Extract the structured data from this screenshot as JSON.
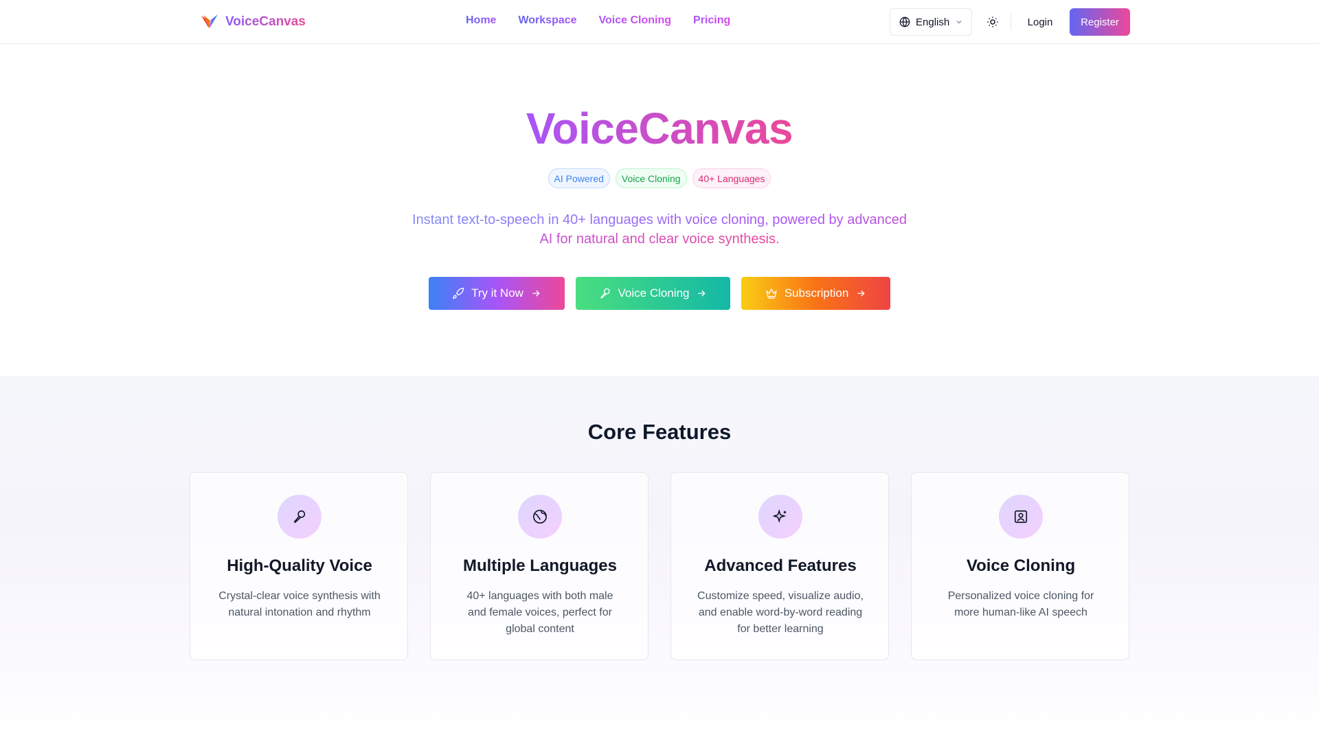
{
  "header": {
    "brand": "VoiceCanvas",
    "nav": [
      "Home",
      "Workspace",
      "Voice Cloning",
      "Pricing"
    ],
    "language": "English",
    "login": "Login",
    "register": "Register"
  },
  "hero": {
    "title": "VoiceCanvas",
    "badges": [
      "AI Powered",
      "Voice Cloning",
      "40+ Languages"
    ],
    "subtitle": "Instant text-to-speech in 40+ languages with voice cloning, powered by advanced AI for natural and clear voice synthesis.",
    "buttons": [
      "Try it Now",
      "Voice Cloning",
      "Subscription"
    ]
  },
  "features": {
    "title": "Core Features",
    "cards": [
      {
        "title": "High-Quality Voice",
        "desc": "Crystal-clear voice synthesis with natural intonation and rhythm",
        "icon": "microphone-icon"
      },
      {
        "title": "Multiple Languages",
        "desc": "40+ languages with both male and female voices, perfect for global content",
        "icon": "globe-icon"
      },
      {
        "title": "Advanced Features",
        "desc": "Customize speed, visualize audio, and enable word-by-word reading for better learning",
        "icon": "sparkles-icon"
      },
      {
        "title": "Voice Cloning",
        "desc": "Personalized voice cloning for more human-like AI speech",
        "icon": "user-square-icon"
      }
    ]
  },
  "colors": {
    "brand_gradient_start": "#8b5cf6",
    "brand_gradient_end": "#ec4899",
    "register_start": "#6366f1",
    "cta_try_start": "#3b82f6",
    "cta_clone_start": "#4ade80",
    "cta_clone_end": "#14b8a6",
    "cta_sub_start": "#facc15",
    "cta_sub_end": "#ef4444"
  }
}
